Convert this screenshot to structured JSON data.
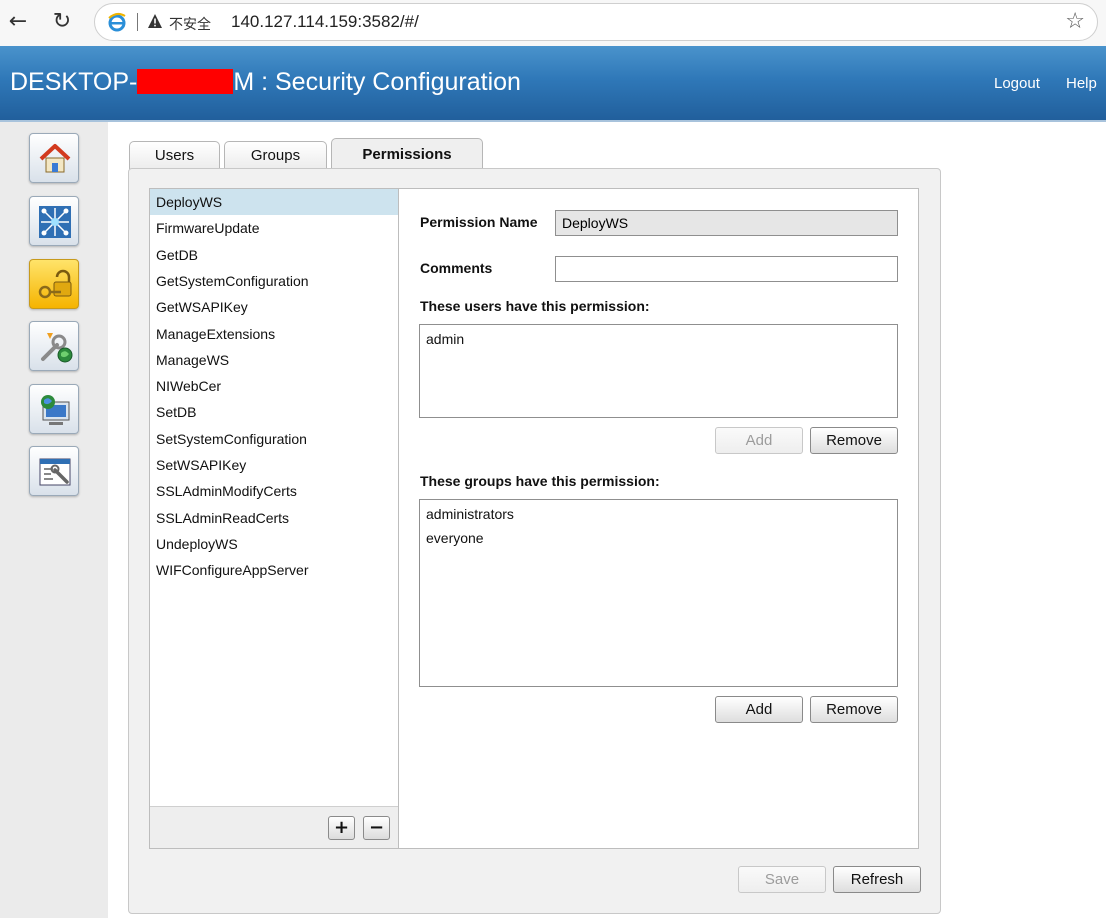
{
  "browser": {
    "back_icon": "←",
    "reload_icon": "↻",
    "security_label": "不安全",
    "url": "140.127.114.159:3582/#/",
    "favorite_icon": "☆"
  },
  "header": {
    "title_prefix": "DESKTOP-",
    "title_suffix": "M : Security Configuration",
    "logout": "Logout",
    "help": "Help"
  },
  "sidebar": {
    "icons": [
      "home-icon",
      "network-config-icon",
      "security-config-icon",
      "software-install-icon",
      "remote-system-icon",
      "system-settings-icon"
    ]
  },
  "tabs": [
    {
      "label": "Users",
      "active": false
    },
    {
      "label": "Groups",
      "active": false
    },
    {
      "label": "Permissions",
      "active": true
    }
  ],
  "permissions": {
    "items": [
      "DeployWS",
      "FirmwareUpdate",
      "GetDB",
      "GetSystemConfiguration",
      "GetWSAPIKey",
      "ManageExtensions",
      "ManageWS",
      "NIWebCer",
      "SetDB",
      "SetSystemConfiguration",
      "SetWSAPIKey",
      "SSLAdminModifyCerts",
      "SSLAdminReadCerts",
      "UndeployWS",
      "WIFConfigureAppServer"
    ],
    "selected": "DeployWS",
    "add_label": "+",
    "remove_label": "−"
  },
  "detail": {
    "permission_name_label": "Permission Name",
    "permission_name_value": "DeployWS",
    "comments_label": "Comments",
    "comments_value": "",
    "users_heading": "These users have this permission:",
    "users": [
      "admin"
    ],
    "users_add": "Add",
    "users_remove": "Remove",
    "groups_heading": "These groups have this permission:",
    "groups": [
      "administrators",
      "everyone"
    ],
    "groups_add": "Add",
    "groups_remove": "Remove"
  },
  "footer": {
    "save": "Save",
    "refresh": "Refresh"
  },
  "colors": {
    "header_blue": "#2f78b8",
    "selection": "#cde3ee",
    "redaction": "#ff0000"
  }
}
